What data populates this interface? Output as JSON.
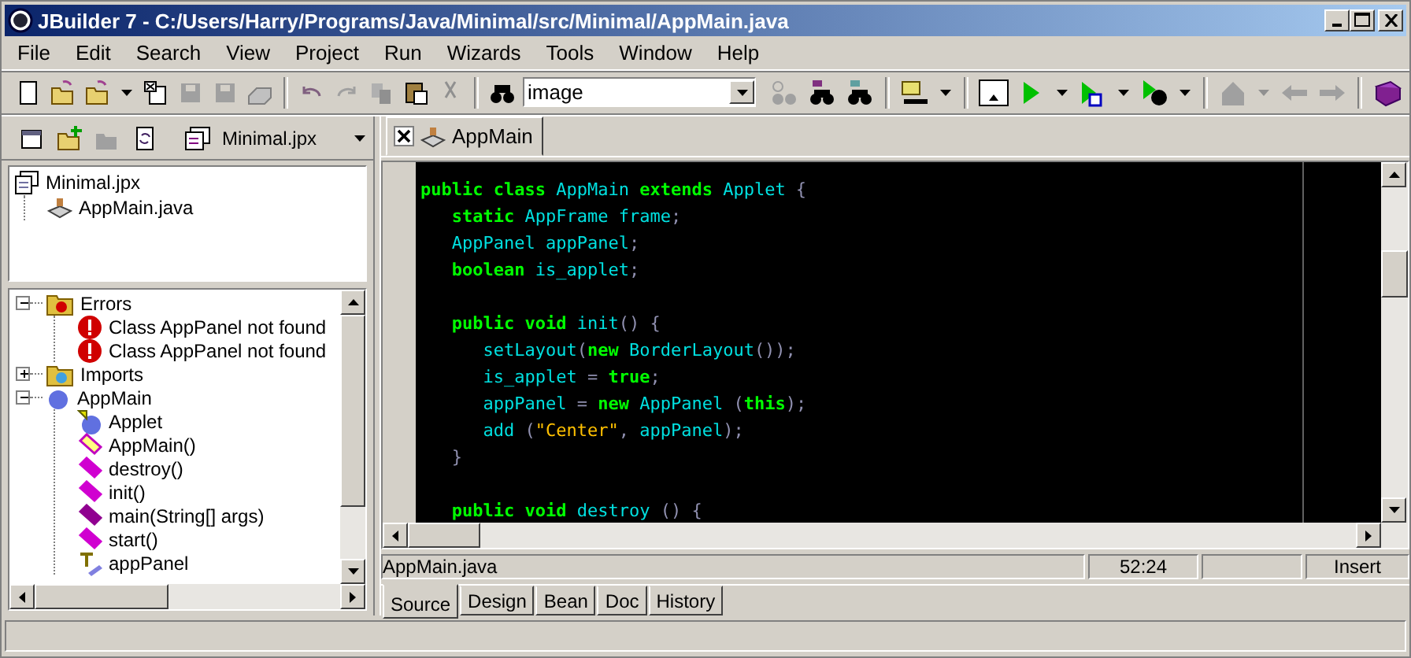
{
  "window": {
    "title": "JBuilder 7 - C:/Users/Harry/Programs/Java/Minimal/src/Minimal/AppMain.java"
  },
  "menu": [
    "File",
    "Edit",
    "Search",
    "View",
    "Project",
    "Run",
    "Wizards",
    "Tools",
    "Window",
    "Help"
  ],
  "search": {
    "value": "image"
  },
  "project_selector": {
    "value": "Minimal.jpx"
  },
  "project_tree": [
    {
      "label": "Minimal.jpx",
      "kind": "project",
      "children": [
        {
          "label": "AppMain.java",
          "kind": "javafile"
        }
      ]
    }
  ],
  "structure_tree": [
    {
      "label": "Errors",
      "kind": "errorfolder",
      "expanded": true,
      "children": [
        {
          "label": "Class AppPanel not found",
          "kind": "error"
        },
        {
          "label": "Class AppPanel not found",
          "kind": "error"
        }
      ]
    },
    {
      "label": "Imports",
      "kind": "importfolder",
      "expanded": false
    },
    {
      "label": "AppMain",
      "kind": "class",
      "expanded": true,
      "children": [
        {
          "label": "Applet",
          "kind": "superclass"
        },
        {
          "label": "AppMain()",
          "kind": "constructor"
        },
        {
          "label": "destroy()",
          "kind": "method"
        },
        {
          "label": "init()",
          "kind": "method"
        },
        {
          "label": "main(String[] args)",
          "kind": "staticmethod"
        },
        {
          "label": "start()",
          "kind": "method"
        },
        {
          "label": "appPanel",
          "kind": "field"
        }
      ]
    }
  ],
  "editor_tabs": [
    {
      "label": "AppMain",
      "selected": true
    }
  ],
  "code": [
    {
      "kind": "code",
      "tokens": [
        {
          "kind": "kw",
          "text": "public class"
        },
        {
          "kind": "id",
          "text": " AppMain"
        },
        {
          "kind": "kw",
          "text": " extends"
        },
        {
          "kind": "id",
          "text": " Applet"
        },
        {
          "kind": "punct",
          "text": " {"
        }
      ]
    },
    {
      "kind": "code",
      "tokens": [
        {
          "kind": "kw",
          "text": "   static"
        },
        {
          "kind": "id",
          "text": " AppFrame frame"
        },
        {
          "kind": "punct",
          "text": ";"
        }
      ]
    },
    {
      "kind": "code",
      "tokens": [
        {
          "kind": "id",
          "text": "   AppPanel appPanel"
        },
        {
          "kind": "punct",
          "text": ";"
        }
      ]
    },
    {
      "kind": "code",
      "tokens": [
        {
          "kind": "kw",
          "text": "   boolean"
        },
        {
          "kind": "id",
          "text": " is_applet"
        },
        {
          "kind": "punct",
          "text": ";"
        }
      ]
    },
    {
      "kind": "blank"
    },
    {
      "kind": "code",
      "tokens": [
        {
          "kind": "kw",
          "text": "   public void"
        },
        {
          "kind": "id",
          "text": " init"
        },
        {
          "kind": "punct",
          "text": "() {"
        }
      ]
    },
    {
      "kind": "code",
      "tokens": [
        {
          "kind": "id",
          "text": "      setLayout"
        },
        {
          "kind": "punct",
          "text": "("
        },
        {
          "kind": "kw",
          "text": "new"
        },
        {
          "kind": "id",
          "text": " BorderLayout"
        },
        {
          "kind": "punct",
          "text": "());"
        }
      ]
    },
    {
      "kind": "code",
      "tokens": [
        {
          "kind": "id",
          "text": "      is_applet "
        },
        {
          "kind": "punct",
          "text": "= "
        },
        {
          "kind": "kw",
          "text": "true"
        },
        {
          "kind": "punct",
          "text": ";"
        }
      ]
    },
    {
      "kind": "code",
      "tokens": [
        {
          "kind": "id",
          "text": "      appPanel "
        },
        {
          "kind": "punct",
          "text": "= "
        },
        {
          "kind": "kw",
          "text": "new"
        },
        {
          "kind": "id",
          "text": " AppPanel "
        },
        {
          "kind": "punct",
          "text": "("
        },
        {
          "kind": "kw",
          "text": "this"
        },
        {
          "kind": "punct",
          "text": ");"
        }
      ]
    },
    {
      "kind": "code",
      "tokens": [
        {
          "kind": "id",
          "text": "      add "
        },
        {
          "kind": "punct",
          "text": "("
        },
        {
          "kind": "str",
          "text": "\"Center\""
        },
        {
          "kind": "punct",
          "text": ", "
        },
        {
          "kind": "id",
          "text": "appPanel"
        },
        {
          "kind": "punct",
          "text": ");"
        }
      ]
    },
    {
      "kind": "code",
      "tokens": [
        {
          "kind": "punct",
          "text": "   }"
        }
      ]
    },
    {
      "kind": "blank"
    },
    {
      "kind": "code",
      "tokens": [
        {
          "kind": "kw",
          "text": "   public void"
        },
        {
          "kind": "id",
          "text": " destroy "
        },
        {
          "kind": "punct",
          "text": "() {"
        }
      ]
    }
  ],
  "status": {
    "file": "AppMain.java",
    "position": "52:24",
    "mode": "Insert"
  },
  "view_tabs": [
    {
      "label": "Source",
      "selected": true
    },
    {
      "label": "Design",
      "selected": false
    },
    {
      "label": "Bean",
      "selected": false
    },
    {
      "label": "Doc",
      "selected": false
    },
    {
      "label": "History",
      "selected": false
    }
  ]
}
